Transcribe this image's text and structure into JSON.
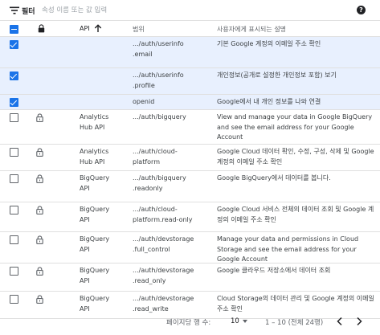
{
  "filter": {
    "label": "필터",
    "placeholder": "속성 이름 또는 값 입력"
  },
  "header": {
    "api": "API",
    "scope": "범위",
    "description": "사용자에게 표시되는 설명"
  },
  "rows": [
    {
      "checked": true,
      "api": "",
      "scope": ".../auth/userinfo\n.email",
      "description": "기본 Google 계정의 이메일 주소 확인"
    },
    {
      "checked": true,
      "api": "",
      "scope": ".../auth/userinfo\n.profile",
      "description": "개인정보(공개로 설정한 개인정보 포함) 보기"
    },
    {
      "checked": true,
      "api": "",
      "scope": "openid",
      "description": "Google에서 내 개인 정보를 나와 연결"
    },
    {
      "checked": false,
      "api": "Analytics\nHub API",
      "scope": ".../auth/bigquery",
      "description": "View and manage your data in Google BigQuery and see the email address for your Google Account"
    },
    {
      "checked": false,
      "api": "Analytics\nHub API",
      "scope": ".../auth/cloud-\nplatform",
      "description": "Google Cloud 데이터 확인, 수정, 구성, 삭제 및 Google 계정의 이메일 주소 확인"
    },
    {
      "checked": false,
      "api": "BigQuery\nAPI",
      "scope": ".../auth/bigquery\n.readonly",
      "description": "Google BigQuery에서 데이터를 봅니다."
    },
    {
      "checked": false,
      "api": "BigQuery\nAPI",
      "scope": ".../auth/cloud-\nplatform.read-only",
      "description": "Google Cloud 서비스 전체의 데이터 조회 및 Google 계정의 이메일 주소 확인"
    },
    {
      "checked": false,
      "api": "BigQuery\nAPI",
      "scope": ".../auth/devstorage\n.full_control",
      "description": "Manage your data and permissions in Cloud Storage and see the email address for your Google Account"
    },
    {
      "checked": false,
      "api": "BigQuery\nAPI",
      "scope": ".../auth/devstorage\n.read_only",
      "description": "Google 클라우드 저장소에서 데이터 조회"
    },
    {
      "checked": false,
      "api": "BigQuery\nAPI",
      "scope": ".../auth/devstorage\n.read_write",
      "description": "Cloud Storage의 데이터 관리 및 Google 계정의 이메일 주소 확인"
    }
  ],
  "footer": {
    "rows_per_page_label": "페이지당 행 수:",
    "rows_per_page": "10",
    "range": "1 – 10 (전체 24행)"
  },
  "colors": {
    "accent": "#1a73e8",
    "selected_row_bg": "#e8f0fe",
    "divider": "#e0e0e0"
  },
  "icons": {
    "filter": "filter-lines-icon",
    "help": "help-circle-icon",
    "lock": "lock-icon",
    "sort": "arrow-up-icon",
    "prev": "chevron-left-icon",
    "next": "chevron-right-icon"
  }
}
